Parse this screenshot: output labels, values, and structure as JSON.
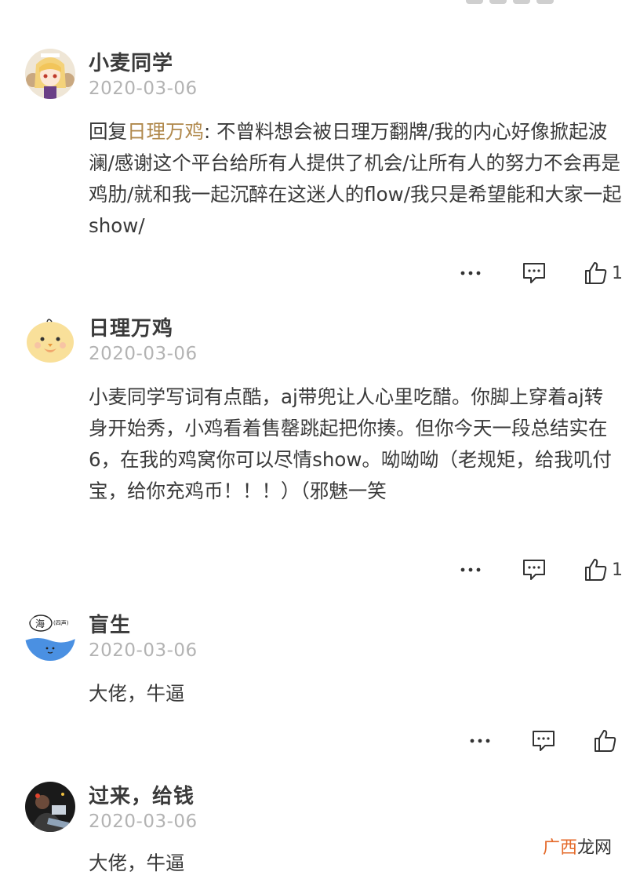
{
  "comments": [
    {
      "username": "小麦同学",
      "date": "2020-03-06",
      "reply_prefix": "回复",
      "reply_target": "日理万鸡",
      "text": ": 不曾料想会被日理万翻牌/我的内心好像掀起波澜/感谢这个平台给所有人提供了机会/让所有人的努力不会再是鸡肋/就和我一起沉醉在这迷人的flow/我只是希望能和大家一起show/",
      "likes": "1",
      "avatar_icon": "anime-girl-avatar"
    },
    {
      "username": "日理万鸡",
      "date": "2020-03-06",
      "text": "小麦同学写词有点酷，aj带兜让人心里吃醋。你脚上穿着aj转身开始秀，小鸡看着售罄跳起把你揍。但你今天一段总结实在6，在我的鸡窝你可以尽情show。呦呦呦（老规矩，给我叽付宝，给你充鸡币！！！）（邪魅一笑",
      "likes": "1",
      "avatar_icon": "chick-avatar"
    },
    {
      "username": "盲生",
      "date": "2020-03-06",
      "text": "大佬，牛逼",
      "likes": "",
      "avatar_icon": "sea-doodle-avatar"
    },
    {
      "username": "过来，给钱",
      "date": "2020-03-06",
      "text": "大佬，牛逼",
      "avatar_icon": "dark-photo-avatar"
    }
  ],
  "watermark": {
    "part1": "广",
    "part2": "西",
    "part3": "龙网"
  },
  "colors": {
    "reply_target": "#b0884b",
    "date": "#b3b3b3",
    "text": "#3a3a3a"
  }
}
